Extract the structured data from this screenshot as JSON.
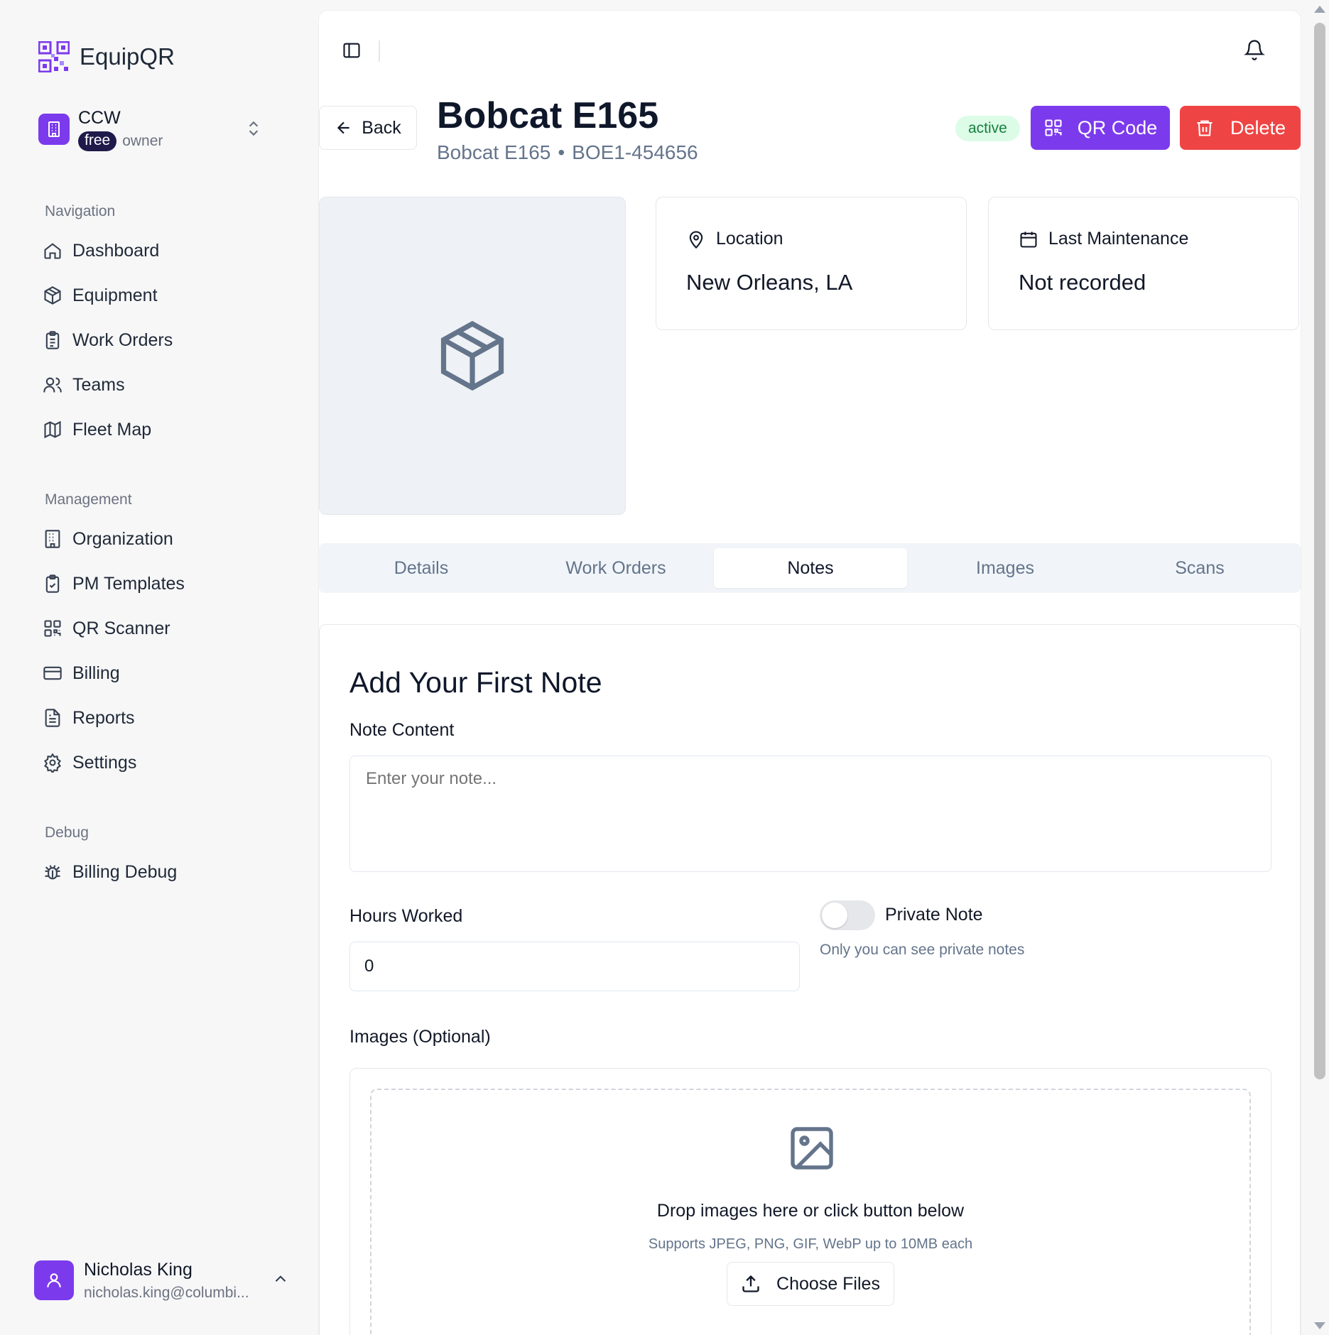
{
  "app": {
    "name": "EquipQR"
  },
  "org": {
    "name": "CCW",
    "plan": "free",
    "role": "owner"
  },
  "sidebar": {
    "sections": [
      {
        "label": "Navigation",
        "items": [
          "Dashboard",
          "Equipment",
          "Work Orders",
          "Teams",
          "Fleet Map"
        ]
      },
      {
        "label": "Management",
        "items": [
          "Organization",
          "PM Templates",
          "QR Scanner",
          "Billing",
          "Reports",
          "Settings"
        ]
      },
      {
        "label": "Debug",
        "items": [
          "Billing Debug"
        ]
      }
    ]
  },
  "user": {
    "name": "Nicholas King",
    "email": "nicholas.king@columbi..."
  },
  "header": {
    "back_label": "Back",
    "title": "Bobcat E165",
    "subtitle_model": "Bobcat E165",
    "subtitle_sep": "•",
    "subtitle_serial": "BOE1-454656",
    "status": "active",
    "qr_label": "QR Code",
    "delete_label": "Delete"
  },
  "cards": {
    "location": {
      "label": "Location",
      "value": "New Orleans, LA"
    },
    "maintenance": {
      "label": "Last Maintenance",
      "value": "Not recorded"
    }
  },
  "tabs": [
    "Details",
    "Work Orders",
    "Notes",
    "Images",
    "Scans"
  ],
  "active_tab": "Notes",
  "note_form": {
    "title": "Add Your First Note",
    "content_label": "Note Content",
    "content_placeholder": "Enter your note...",
    "hours_label": "Hours Worked",
    "hours_value": "0",
    "private_label": "Private Note",
    "private_help": "Only you can see private notes",
    "private_on": false,
    "images_label": "Images (Optional)",
    "drop_title": "Drop images here or click button below",
    "drop_sub": "Supports JPEG, PNG, GIF, WebP up to 10MB each",
    "choose_label": "Choose Files"
  },
  "colors": {
    "accent": "#7c3aed",
    "danger": "#ef4444",
    "status_bg": "#dcfce7",
    "status_fg": "#15803d"
  }
}
